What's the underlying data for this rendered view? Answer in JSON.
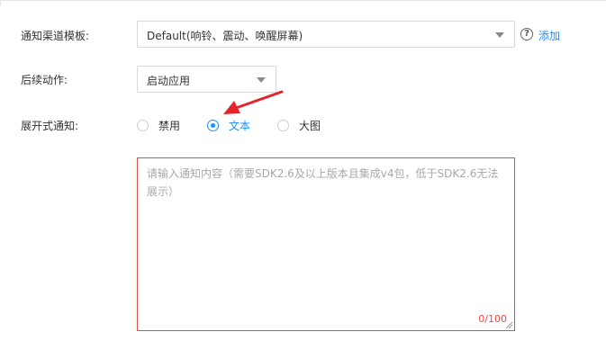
{
  "form": {
    "channel_template": {
      "label": "通知渠道模板:",
      "selected": "Default(响铃、震动、唤醒屏幕)",
      "help_glyph": "?",
      "add_link": "添加"
    },
    "follow_action": {
      "label": "后续动作:",
      "selected": "启动应用"
    },
    "expand_notification": {
      "label": "展开式通知:",
      "options": [
        {
          "label": "禁用",
          "checked": false
        },
        {
          "label": "文本",
          "checked": true
        },
        {
          "label": "大图",
          "checked": false
        }
      ]
    },
    "content": {
      "placeholder": "请输入通知内容（需要SDK2.6及以上版本且集成v4包，低于SDK2.6无法展示）",
      "counter": "0/100"
    }
  },
  "colors": {
    "accent": "#1890ff",
    "link": "#2d8cf0",
    "error": "#e74c3c",
    "annotation_arrow": "#e8232c"
  }
}
